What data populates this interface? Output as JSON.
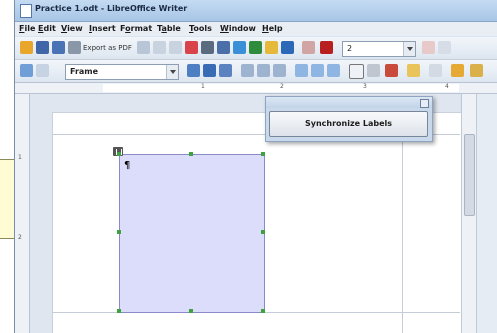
{
  "window": {
    "title": "Practice 1.odt - LibreOffice Writer"
  },
  "menu": [
    "File",
    "Edit",
    "View",
    "Insert",
    "Format",
    "Table",
    "Tools",
    "Window",
    "Help"
  ],
  "menu_mnemonics": [
    "F",
    "E",
    "V",
    "I",
    "o",
    "a",
    "T",
    "W",
    "H"
  ],
  "toolbar": {
    "export_pdf_label": "Export as PDF",
    "font_size_value": "2",
    "style_value": "Frame"
  },
  "ruler": {
    "numbers": [
      "1",
      "2",
      "3",
      "4"
    ]
  },
  "vruler": {
    "numbers": [
      "1",
      "2"
    ]
  },
  "document": {
    "paragraph_mark": "¶"
  },
  "labels_window": {
    "sync_button_label": "Synchronize Labels"
  },
  "colors": {
    "frame_fill": "#dcdcfb",
    "handle": "#3fa23f",
    "callout": "#fffbd3"
  }
}
